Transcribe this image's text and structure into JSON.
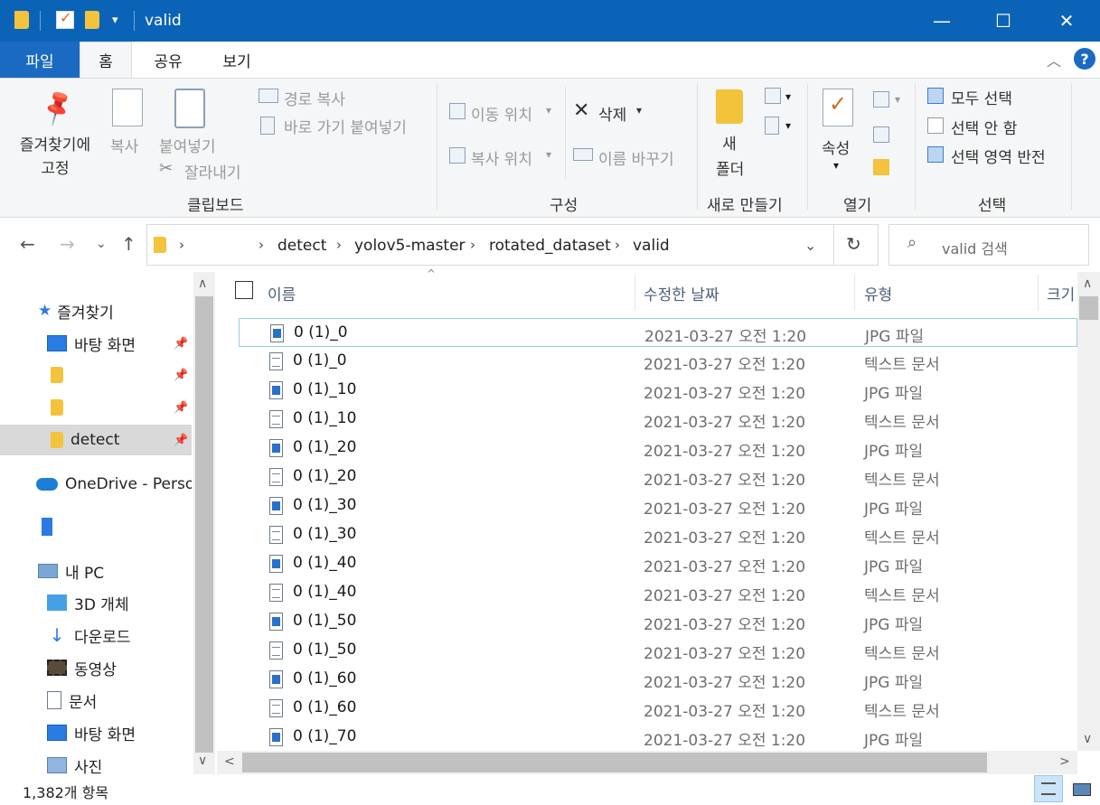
{
  "window": {
    "title": "valid",
    "controls": {
      "minimize": "—",
      "maximize": "☐",
      "close": "✕"
    }
  },
  "tabs": {
    "file": "파일",
    "home": "홈",
    "share": "공유",
    "view": "보기"
  },
  "ribbon": {
    "clipboard": {
      "pin": "즐겨찾기에\n고정",
      "pin_line1": "즐겨찾기에",
      "pin_line2": "고정",
      "copy": "복사",
      "paste": "붙여넣기",
      "copy_path": "경로 복사",
      "paste_shortcut": "바로 가기 붙여넣기",
      "cut": "잘라내기",
      "label": "클립보드"
    },
    "organize": {
      "move_to": "이동 위치",
      "copy_to": "복사 위치",
      "delete": "삭제",
      "rename": "이름 바꾸기",
      "label": "구성"
    },
    "new": {
      "new_folder_line1": "새",
      "new_folder_line2": "폴더",
      "label": "새로 만들기"
    },
    "open": {
      "properties": "속성",
      "label": "열기"
    },
    "select": {
      "select_all": "모두 선택",
      "select_none": "선택 안 함",
      "invert": "선택 영역 반전",
      "label": "선택"
    }
  },
  "address": {
    "crumbs": [
      "detect",
      "yolov5-master",
      "rotated_dataset",
      "valid"
    ],
    "search_placeholder": "valid 검색"
  },
  "sidebar": {
    "quick_access": "즐겨찾기",
    "items": [
      {
        "label": "바탕 화면"
      },
      {
        "label": ""
      },
      {
        "label": ""
      },
      {
        "label": "detect"
      }
    ],
    "onedrive": "OneDrive - Persor",
    "this_pc": "내 PC",
    "pc_items": [
      "3D 개체",
      "다운로드",
      "동영상",
      "문서",
      "바탕 화면",
      "사진"
    ]
  },
  "columns": {
    "name": "이름",
    "date": "수정한 날짜",
    "type": "유형",
    "size": "크기"
  },
  "files": [
    {
      "name": "0 (1)_0",
      "date": "2021-03-27 오전 1:20",
      "type": "JPG 파일",
      "kind": "img"
    },
    {
      "name": "0 (1)_0",
      "date": "2021-03-27 오전 1:20",
      "type": "텍스트 문서",
      "kind": "txt"
    },
    {
      "name": "0 (1)_10",
      "date": "2021-03-27 오전 1:20",
      "type": "JPG 파일",
      "kind": "img"
    },
    {
      "name": "0 (1)_10",
      "date": "2021-03-27 오전 1:20",
      "type": "텍스트 문서",
      "kind": "txt"
    },
    {
      "name": "0 (1)_20",
      "date": "2021-03-27 오전 1:20",
      "type": "JPG 파일",
      "kind": "img"
    },
    {
      "name": "0 (1)_20",
      "date": "2021-03-27 오전 1:20",
      "type": "텍스트 문서",
      "kind": "txt"
    },
    {
      "name": "0 (1)_30",
      "date": "2021-03-27 오전 1:20",
      "type": "JPG 파일",
      "kind": "img"
    },
    {
      "name": "0 (1)_30",
      "date": "2021-03-27 오전 1:20",
      "type": "텍스트 문서",
      "kind": "txt"
    },
    {
      "name": "0 (1)_40",
      "date": "2021-03-27 오전 1:20",
      "type": "JPG 파일",
      "kind": "img"
    },
    {
      "name": "0 (1)_40",
      "date": "2021-03-27 오전 1:20",
      "type": "텍스트 문서",
      "kind": "txt"
    },
    {
      "name": "0 (1)_50",
      "date": "2021-03-27 오전 1:20",
      "type": "JPG 파일",
      "kind": "img"
    },
    {
      "name": "0 (1)_50",
      "date": "2021-03-27 오전 1:20",
      "type": "텍스트 문서",
      "kind": "txt"
    },
    {
      "name": "0 (1)_60",
      "date": "2021-03-27 오전 1:20",
      "type": "JPG 파일",
      "kind": "img"
    },
    {
      "name": "0 (1)_60",
      "date": "2021-03-27 오전 1:20",
      "type": "텍스트 문서",
      "kind": "txt"
    },
    {
      "name": "0 (1)_70",
      "date": "2021-03-27 오전 1:20",
      "type": "JPG 파일",
      "kind": "img"
    }
  ],
  "status": {
    "count": "1,382개 항목"
  },
  "colors": {
    "titlebar": "#0b63b8",
    "file_tab": "#1b6ac2",
    "folder": "#f3c33c",
    "help": "#1b6ac2"
  }
}
